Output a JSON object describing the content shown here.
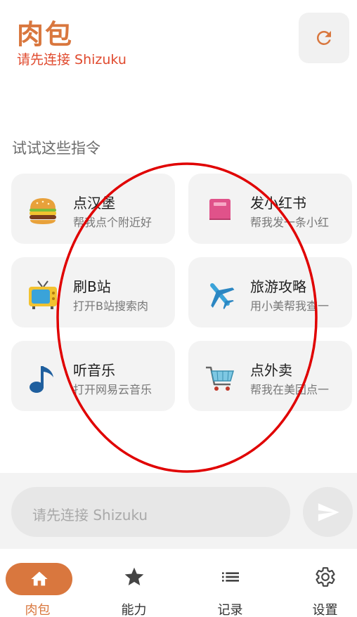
{
  "header": {
    "title": "肉包",
    "subtitle": "请先连接 Shizuku",
    "refresh_icon": "refresh-icon"
  },
  "suggestions": {
    "label": "试试这些指令",
    "cards": [
      {
        "title": "点汉堡",
        "desc": "帮我点个附近好",
        "icon": "hamburger-icon"
      },
      {
        "title": "发小红书",
        "desc": "帮我发一条小红",
        "icon": "book-icon"
      },
      {
        "title": "刷B站",
        "desc": "打开B站搜索肉",
        "icon": "tv-icon"
      },
      {
        "title": "旅游攻略",
        "desc": "用小美帮我查一",
        "icon": "airplane-icon"
      },
      {
        "title": "听音乐",
        "desc": "打开网易云音乐",
        "icon": "music-note-icon"
      },
      {
        "title": "点外卖",
        "desc": "帮我在美团点一",
        "icon": "shopping-cart-icon"
      }
    ]
  },
  "composer": {
    "placeholder": "请先连接 Shizuku",
    "send_icon": "send-icon"
  },
  "nav": {
    "items": [
      {
        "label": "肉包",
        "icon": "home-icon",
        "active": true
      },
      {
        "label": "能力",
        "icon": "star-icon",
        "active": false
      },
      {
        "label": "记录",
        "icon": "list-icon",
        "active": false
      },
      {
        "label": "设置",
        "icon": "gear-icon",
        "active": false
      }
    ]
  },
  "colors": {
    "accent": "#d9773e",
    "subtitle": "#e04a2e",
    "annotation": "#e00000"
  }
}
